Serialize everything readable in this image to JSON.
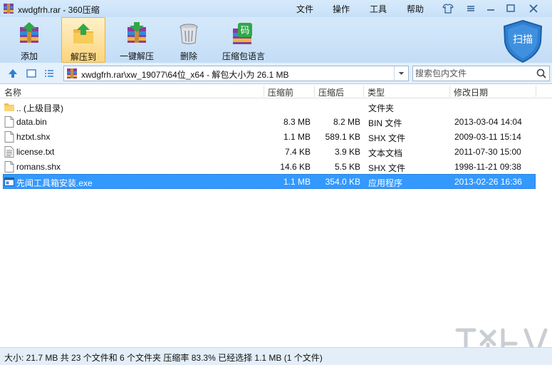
{
  "window": {
    "title": "xwdgfrh.rar - 360压缩"
  },
  "menu": [
    {
      "id": "file",
      "label": "文件"
    },
    {
      "id": "ops",
      "label": "操作"
    },
    {
      "id": "tools",
      "label": "工具"
    },
    {
      "id": "help",
      "label": "帮助"
    }
  ],
  "toolbar": {
    "add": "添加",
    "extract_to": "解压到",
    "one_click_extract": "一键解压",
    "delete": "删除",
    "encoding": "压缩包语言"
  },
  "scan": {
    "label": "扫描"
  },
  "address": {
    "path": "xwdgfrh.rar\\xw_19077\\64位_x64 - 解包大小为 26.1 MB"
  },
  "search": {
    "placeholder": "搜索包内文件"
  },
  "columns": {
    "name": "名称",
    "packed": "压缩前",
    "unpacked": "压缩后",
    "type": "类型",
    "modified": "修改日期"
  },
  "files": [
    {
      "name": ".. (上级目录)",
      "packed": "",
      "unpacked": "",
      "type": "文件夹",
      "modified": "",
      "icon": "folder-icon"
    },
    {
      "name": "data.bin",
      "packed": "8.3 MB",
      "unpacked": "8.2 MB",
      "type": "BIN 文件",
      "modified": "2013-03-04 14:04",
      "icon": "file-icon"
    },
    {
      "name": "hztxt.shx",
      "packed": "1.1 MB",
      "unpacked": "589.1 KB",
      "type": "SHX 文件",
      "modified": "2009-03-11 15:14",
      "icon": "file-icon"
    },
    {
      "name": "license.txt",
      "packed": "7.4 KB",
      "unpacked": "3.9 KB",
      "type": "文本文档",
      "modified": "2011-07-30 15:00",
      "icon": "text-file-icon"
    },
    {
      "name": "romans.shx",
      "packed": "14.6 KB",
      "unpacked": "5.5 KB",
      "type": "SHX 文件",
      "modified": "1998-11-21 09:38",
      "icon": "file-icon"
    },
    {
      "name": "先闻工具箱安装.exe",
      "packed": "1.1 MB",
      "unpacked": "354.0 KB",
      "type": "应用程序",
      "modified": "2013-02-26 16:36",
      "icon": "exe-icon",
      "selected": true
    }
  ],
  "status": {
    "text": "大小: 21.7 MB 共 23 个文件和 6 个文件夹 压缩率 83.3% 已经选择 1.1 MB (1 个文件)"
  },
  "colors": {
    "selection": "#3399ff",
    "background": "#dcecfb",
    "accent": "#2f7fd1"
  }
}
